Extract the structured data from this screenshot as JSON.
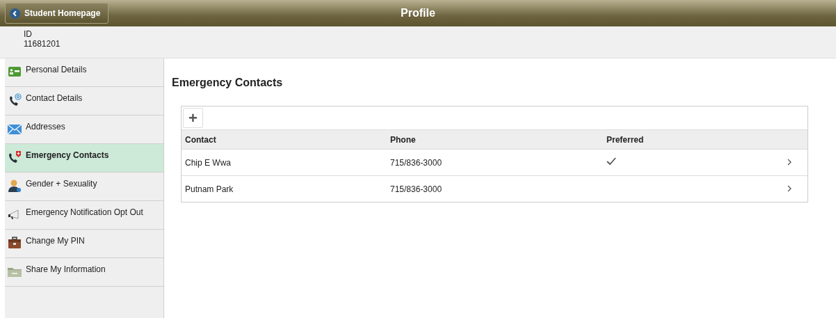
{
  "header": {
    "back_button": "Student Homepage",
    "title": "Profile"
  },
  "id_block": {
    "label": "ID",
    "value": "11681201"
  },
  "sidebar": {
    "items": [
      {
        "label": "Personal Details",
        "kind": "card",
        "selected": false
      },
      {
        "label": "Contact Details",
        "kind": "phone-at",
        "selected": false
      },
      {
        "label": "Addresses",
        "kind": "envelope",
        "selected": false
      },
      {
        "label": "Emergency Contacts",
        "kind": "phone-cross",
        "selected": true
      },
      {
        "label": "Gender + Sexuality",
        "kind": "person",
        "selected": false
      },
      {
        "label": "Emergency Notification Opt Out",
        "kind": "megaphone",
        "selected": false
      },
      {
        "label": "Change My PIN",
        "kind": "briefcase",
        "selected": false
      },
      {
        "label": "Share My Information",
        "kind": "folder",
        "selected": false
      }
    ]
  },
  "main": {
    "title": "Emergency Contacts",
    "add_button": "+",
    "table": {
      "columns": [
        "Contact",
        "Phone",
        "Preferred"
      ],
      "rows": [
        {
          "contact": "Chip E Wwa",
          "phone": "715/836-3000",
          "preferred": true
        },
        {
          "contact": "Putnam Park",
          "phone": "715/836-3000",
          "preferred": false
        }
      ]
    }
  }
}
